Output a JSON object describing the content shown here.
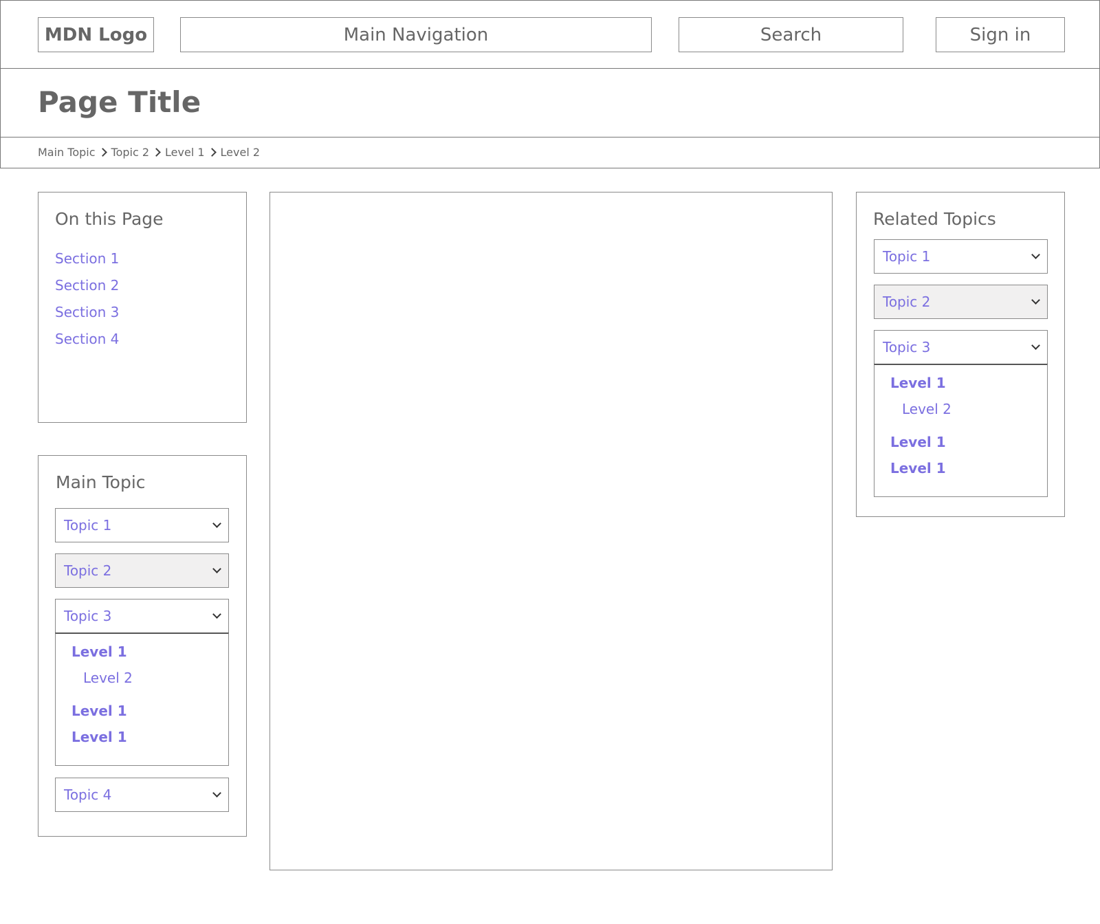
{
  "header": {
    "logo": "MDN Logo",
    "main_navigation": "Main Navigation",
    "search": "Search",
    "sign_in": "Sign in",
    "page_title": "Page Title",
    "breadcrumbs": [
      "Main Topic",
      "Topic 2",
      "Level 1",
      "Level 2"
    ]
  },
  "on_this_page": {
    "title": "On this Page",
    "sections": [
      "Section 1",
      "Section 2",
      "Section 3",
      "Section 4"
    ]
  },
  "main_topic": {
    "title": "Main Topic",
    "topics": [
      "Topic 1",
      "Topic 2",
      "Topic 3",
      "Topic 4"
    ],
    "expanded": {
      "level1_a": "Level 1",
      "level2": "Level 2",
      "level1_b": "Level 1",
      "level1_c": "Level 1"
    }
  },
  "related_topics": {
    "title": "Related Topics",
    "topics": [
      "Topic 1",
      "Topic 2",
      "Topic 3"
    ],
    "expanded": {
      "level1_a": "Level 1",
      "level2": "Level 2",
      "level1_b": "Level 1",
      "level1_c": "Level 1"
    }
  },
  "colors": {
    "link": "#7b6fe0",
    "border": "#8a8a8a",
    "text": "#666666",
    "shaded": "#f1f0f0"
  },
  "icons": {
    "breadcrumb_separator": "chevron-right-icon",
    "dropdown": "chevron-down-icon"
  }
}
